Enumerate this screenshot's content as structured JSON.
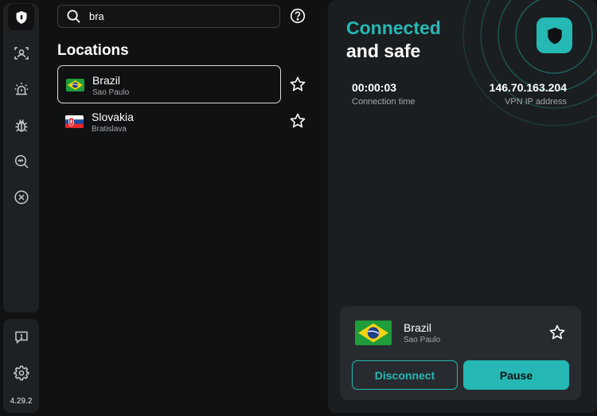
{
  "sidebar": {
    "items": [
      {
        "icon": "shield-icon",
        "label": "VPN"
      },
      {
        "icon": "face-scan-icon",
        "label": "Identity"
      },
      {
        "icon": "alarm-icon",
        "label": "Alerts"
      },
      {
        "icon": "bug-icon",
        "label": "Threats"
      },
      {
        "icon": "search-scan-icon",
        "label": "Scan"
      },
      {
        "icon": "block-icon",
        "label": "Blocker"
      }
    ],
    "bottom": [
      {
        "icon": "feedback-icon"
      },
      {
        "icon": "gear-icon"
      }
    ],
    "version": "4.29.2"
  },
  "search": {
    "value": "bra",
    "placeholder": "Search"
  },
  "locations": {
    "title": "Locations",
    "items": [
      {
        "name": "Brazil",
        "city": "Sao Paulo",
        "flag": "brazil-flag-icon",
        "selected": true
      },
      {
        "name": "Slovakia",
        "city": "Bratislava",
        "flag": "slovakia-flag-icon",
        "selected": false
      }
    ]
  },
  "status": {
    "line1": "Connected",
    "line2": "and safe",
    "connection_time_value": "00:00:03",
    "connection_time_label": "Connection time",
    "ip_value": "146.70.163.204",
    "ip_label": "VPN IP address"
  },
  "current": {
    "name": "Brazil",
    "city": "Sao Paulo",
    "disconnect_label": "Disconnect",
    "pause_label": "Pause"
  },
  "colors": {
    "accent": "#26b8b4",
    "background": "#0f1113",
    "panel": "#1b1e21",
    "card": "#272b2f"
  }
}
